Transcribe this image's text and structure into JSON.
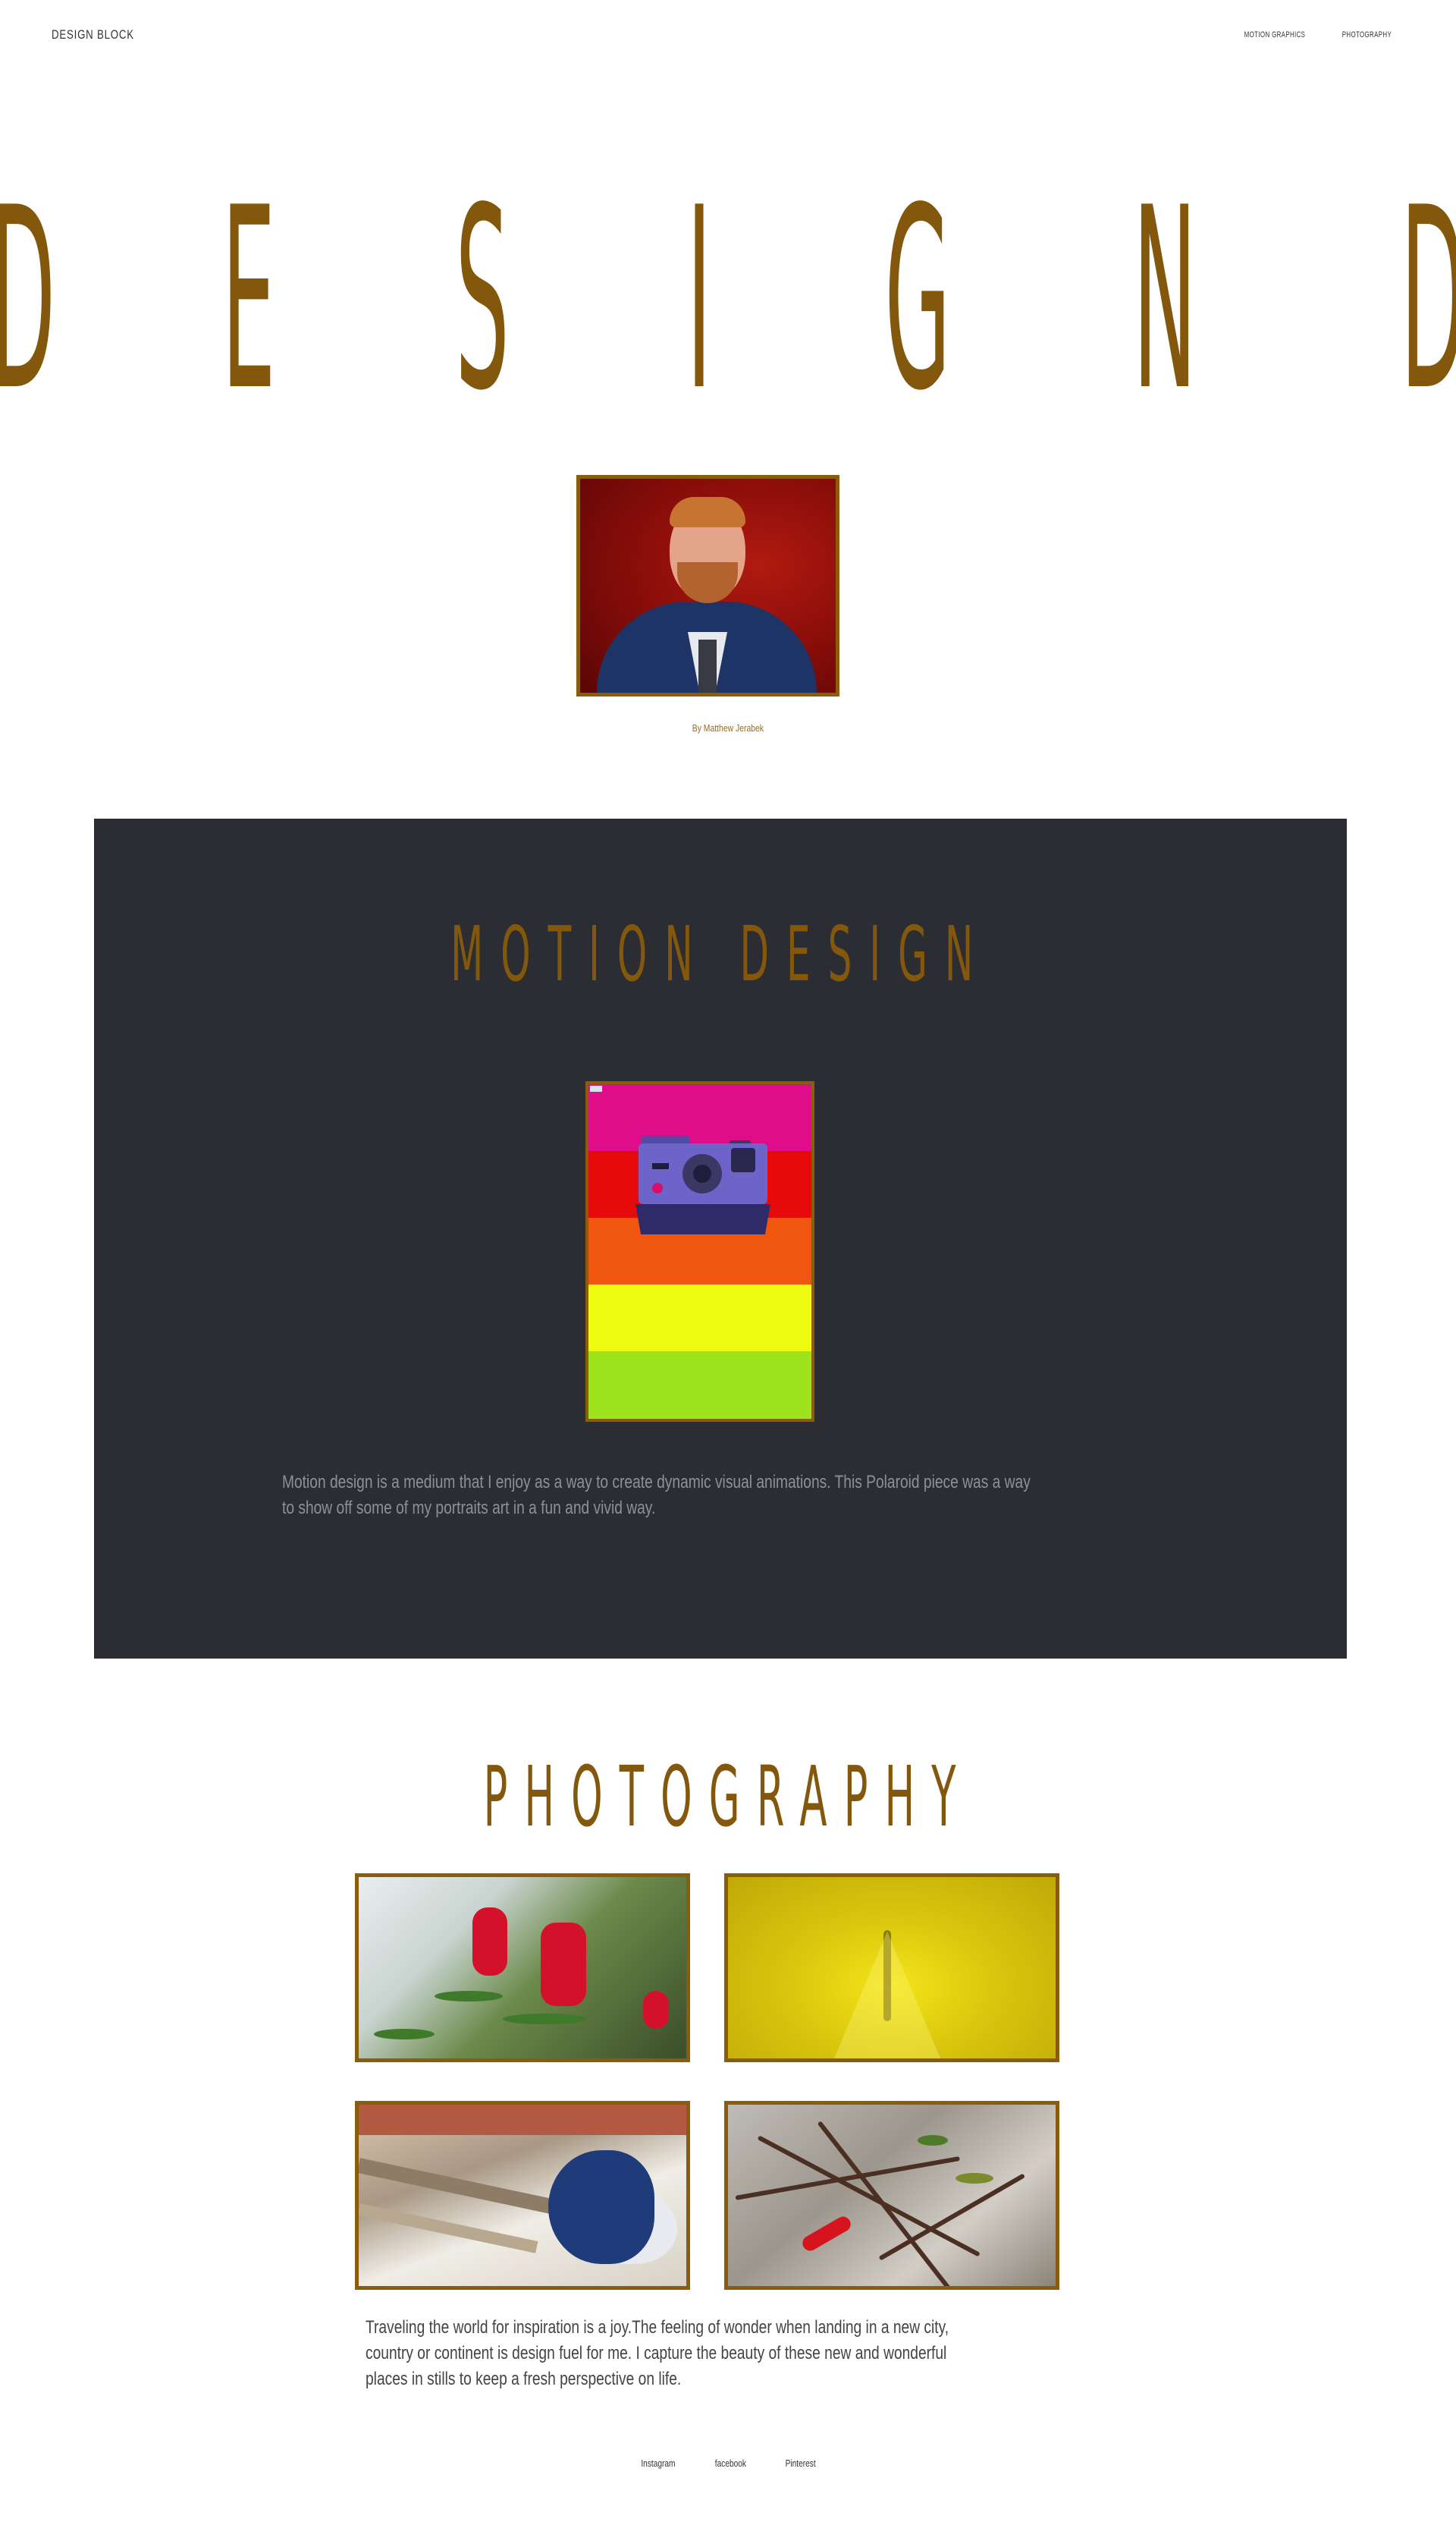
{
  "header": {
    "brand": "DESIGN BLOCK",
    "nav": [
      {
        "label": "MOTION GRAPHICS"
      },
      {
        "label": "PHOTOGRAPHY"
      }
    ]
  },
  "hero": {
    "letters": [
      "D",
      "E",
      "S",
      "I",
      "G",
      "N",
      "D"
    ],
    "color": "#84580c"
  },
  "portrait": {
    "byline": "By Matthew Jerabek"
  },
  "motion": {
    "title": "MOTION DESIGN",
    "polaroid_stripes": [
      "#e00d8a",
      "#e60a0a",
      "#f0560e",
      "#eefa0f",
      "#9ee41d"
    ],
    "text": "Motion design is a medium that I enjoy  as a way to create  dynamic visual animations. This Polaroid piece was a way to show off some of my portraits art in a fun and vivid way."
  },
  "photography": {
    "title": "PHOTOGRAPHY",
    "text": "Traveling the world for inspiration is a joy.The feeling of wonder when landing in a new city, country or continent is design fuel for me. I capture the beauty of these new and wonderful places in stills to keep a fresh perspective on life."
  },
  "footer": {
    "links": [
      {
        "label": "Instagram"
      },
      {
        "label": "facebook"
      },
      {
        "label": "Pinterest"
      }
    ]
  },
  "colors": {
    "accent": "#84580c",
    "dark_panel": "#2c2d33"
  }
}
